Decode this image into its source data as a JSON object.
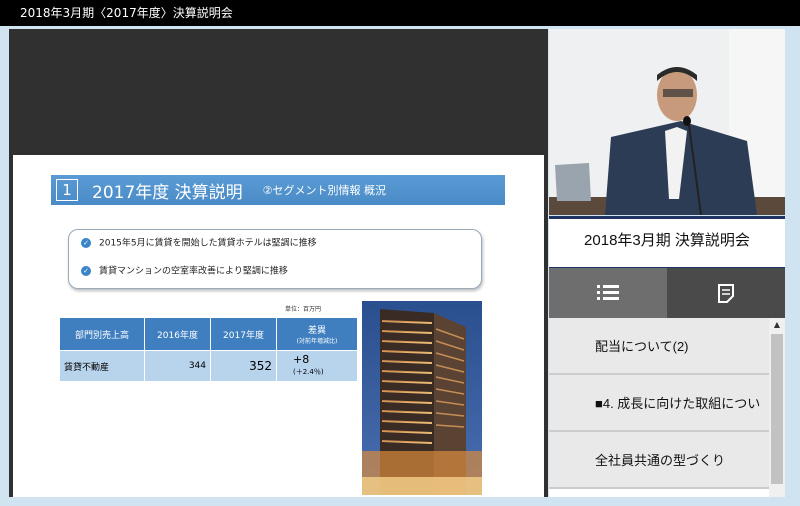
{
  "window": {
    "title": "2018年3月期〈2017年度〉決算説明会"
  },
  "slide": {
    "number": "1",
    "title": "2017年度 決算説明",
    "subtitle": "②セグメント別情報 概況",
    "bullets": [
      "2015年5月に賃貸を開始した賃貸ホテルは堅調に推移",
      "賃貸マンションの空室率改善により堅調に推移"
    ],
    "unit": "単位：百万円",
    "table": {
      "headers": [
        "部門別売上高",
        "2016年度",
        "2017年度",
        "差異"
      ],
      "diff_sub": "(対前年増減比)",
      "row": {
        "label": "賃貸不動産",
        "v2016": "344",
        "v2017": "352",
        "diff": "+8",
        "diff_pct": "(＋2.4％)"
      }
    }
  },
  "video": {
    "banner": "2018年3月期 決算説明会"
  },
  "tabs": [
    {
      "icon": "list-icon"
    },
    {
      "icon": "notes-icon"
    }
  ],
  "agenda": {
    "items": [
      {
        "label": "配当について(2)"
      },
      {
        "label": "■4. 成長に向けた取組につい"
      },
      {
        "label": "全社員共通の型づくり"
      }
    ]
  },
  "colors": {
    "slide_header": "#5b9bd5",
    "table_header": "#3f7fc0",
    "table_cell": "#b8d3ec",
    "banner_border": "#1e3464"
  }
}
